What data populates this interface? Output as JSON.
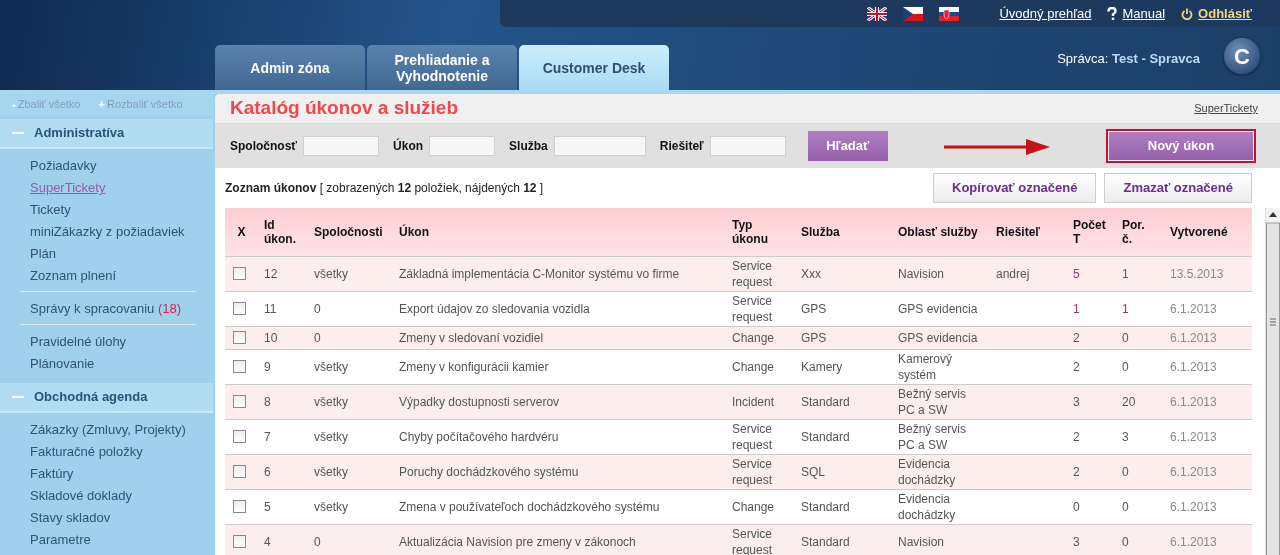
{
  "top_links": [
    {
      "kind": "home",
      "label": "Úvodný prehľad"
    },
    {
      "kind": "help",
      "label": "Manual"
    },
    {
      "kind": "logout",
      "label": "Odhlásiť"
    }
  ],
  "tabs": [
    {
      "label": "Admin zóna",
      "selected": false
    },
    {
      "label": "Prehliadanie a Vyhodnotenie",
      "selected": false
    },
    {
      "label": "Customer Desk",
      "selected": true
    }
  ],
  "user": {
    "role": "Správca:",
    "name": "Test - Spravca"
  },
  "logo": {
    "letter": "C"
  },
  "sidebar": {
    "tools": [
      {
        "icon": "-",
        "label": "Zbaliť všetko"
      },
      {
        "icon": "+",
        "label": "Rozbaliť všetko"
      }
    ],
    "sections": [
      {
        "title": "Administratíva",
        "expanded": true,
        "groups": [
          [
            {
              "label": "Požiadavky",
              "selected": false
            },
            {
              "label": "SuperTickety",
              "selected": true
            },
            {
              "label": "Tickety",
              "selected": false
            },
            {
              "label": "miniZákazky z požiadaviek",
              "selected": false
            },
            {
              "label": "Plán",
              "selected": false
            },
            {
              "label": "Zoznam plnení",
              "selected": false
            }
          ],
          [
            {
              "label": "Správy k spracovaniu",
              "count": "(18)",
              "selected": false
            }
          ],
          [
            {
              "label": "Pravidelné úlohy",
              "selected": false
            },
            {
              "label": "Plánovanie",
              "selected": false
            }
          ]
        ]
      },
      {
        "title": "Obchodná agenda",
        "expanded": true,
        "groups": [
          [
            {
              "label": "Zákazky (Zmluvy, Projekty)",
              "selected": false
            },
            {
              "label": "Fakturačné položky",
              "selected": false
            },
            {
              "label": "Faktúry",
              "selected": false
            },
            {
              "label": "Skladové doklady",
              "selected": false
            },
            {
              "label": "Stavy skladov",
              "selected": false
            },
            {
              "label": "Parametre",
              "selected": false
            }
          ]
        ]
      }
    ]
  },
  "page": {
    "title": "Katalóg úkonov a služieb",
    "link": "SuperTickety"
  },
  "filters": [
    {
      "label": "Spoločnosť"
    },
    {
      "label": "Úkon"
    },
    {
      "label": "Služba"
    },
    {
      "label": "Riešiteľ"
    }
  ],
  "search_button": "Hľadať",
  "new_button": {
    "label": "Nový úkon",
    "highlighted": true
  },
  "list": {
    "title": "Zoznam úkonov",
    "summary": "[ zobrazených **12** položiek, nájdených **12** ]"
  },
  "actions": [
    "Kopírovať označené",
    "Zmazať označené"
  ],
  "table": {
    "columns": [
      "X",
      "Id úkon.",
      "Spoločnosti",
      "Úkon",
      "Typ úkonu",
      "Služba",
      "Oblasť služby",
      "Riešiteľ",
      "Počet T",
      "Por. č.",
      "Vytvorené"
    ],
    "rows": [
      {
        "checked": false,
        "linked": true,
        "id": "12",
        "companies": "všetky",
        "task": "Základná implementácia C-Monitor systému vo firme",
        "type": "Service request",
        "service": "Xxx",
        "area": "Navision",
        "solver": "andrej",
        "count": "5",
        "order": "1",
        "created": "13.5.2013"
      },
      {
        "checked": false,
        "linked": true,
        "id": "11",
        "companies": "0",
        "task": "Export údajov zo sledovania vozidla",
        "type": "Service request",
        "service": "GPS",
        "area": "GPS evidencia",
        "count": "1",
        "order": "1",
        "created": "6.1.2013"
      },
      {
        "checked": false,
        "linked": false,
        "id": "10",
        "companies": "0",
        "task": "Zmeny v sledovaní vozidiel",
        "type": "Change",
        "service": "GPS",
        "area": "GPS evidencia",
        "count": "2",
        "order": "0",
        "created": "6.1.2013"
      },
      {
        "checked": false,
        "linked": false,
        "id": "9",
        "companies": "všetky",
        "task": "Zmeny v konfigurácii kamier",
        "type": "Change",
        "service": "Kamery",
        "area": "Kamerový systém",
        "count": "2",
        "order": "0",
        "created": "6.1.2013"
      },
      {
        "checked": false,
        "linked": false,
        "id": "8",
        "companies": "všetky",
        "task": "Výpadky dostupnosti serverov",
        "type": "Incident",
        "service": "Standard",
        "area": "Bežný servis PC a SW",
        "count": "3",
        "order": "20",
        "created": "6.1.2013"
      },
      {
        "checked": false,
        "linked": false,
        "id": "7",
        "companies": "všetky",
        "task": "Chyby počítačového hardvéru",
        "type": "Service request",
        "service": "Standard",
        "area": "Bežný servis PC a SW",
        "count": "2",
        "order": "3",
        "created": "6.1.2013"
      },
      {
        "checked": false,
        "linked": false,
        "id": "6",
        "companies": "všetky",
        "task": "Poruchy dochádzkového systému",
        "type": "Service request",
        "service": "SQL",
        "area": "Evidencia dochádzky",
        "count": "2",
        "order": "0",
        "created": "6.1.2013"
      },
      {
        "checked": false,
        "linked": false,
        "id": "5",
        "companies": "všetky",
        "task": "Zmena v používateľoch dochádzkového systému",
        "type": "Change",
        "service": "Standard",
        "area": "Evidencia dochádzky",
        "count": "0",
        "order": "0",
        "created": "6.1.2013"
      },
      {
        "checked": false,
        "linked": false,
        "id": "4",
        "companies": "0",
        "task": "Aktualizácia Navision pre zmeny v zákonoch",
        "type": "Service request",
        "service": "Standard",
        "area": "Navision",
        "count": "3",
        "order": "0",
        "created": "6.1.2013"
      }
    ]
  }
}
